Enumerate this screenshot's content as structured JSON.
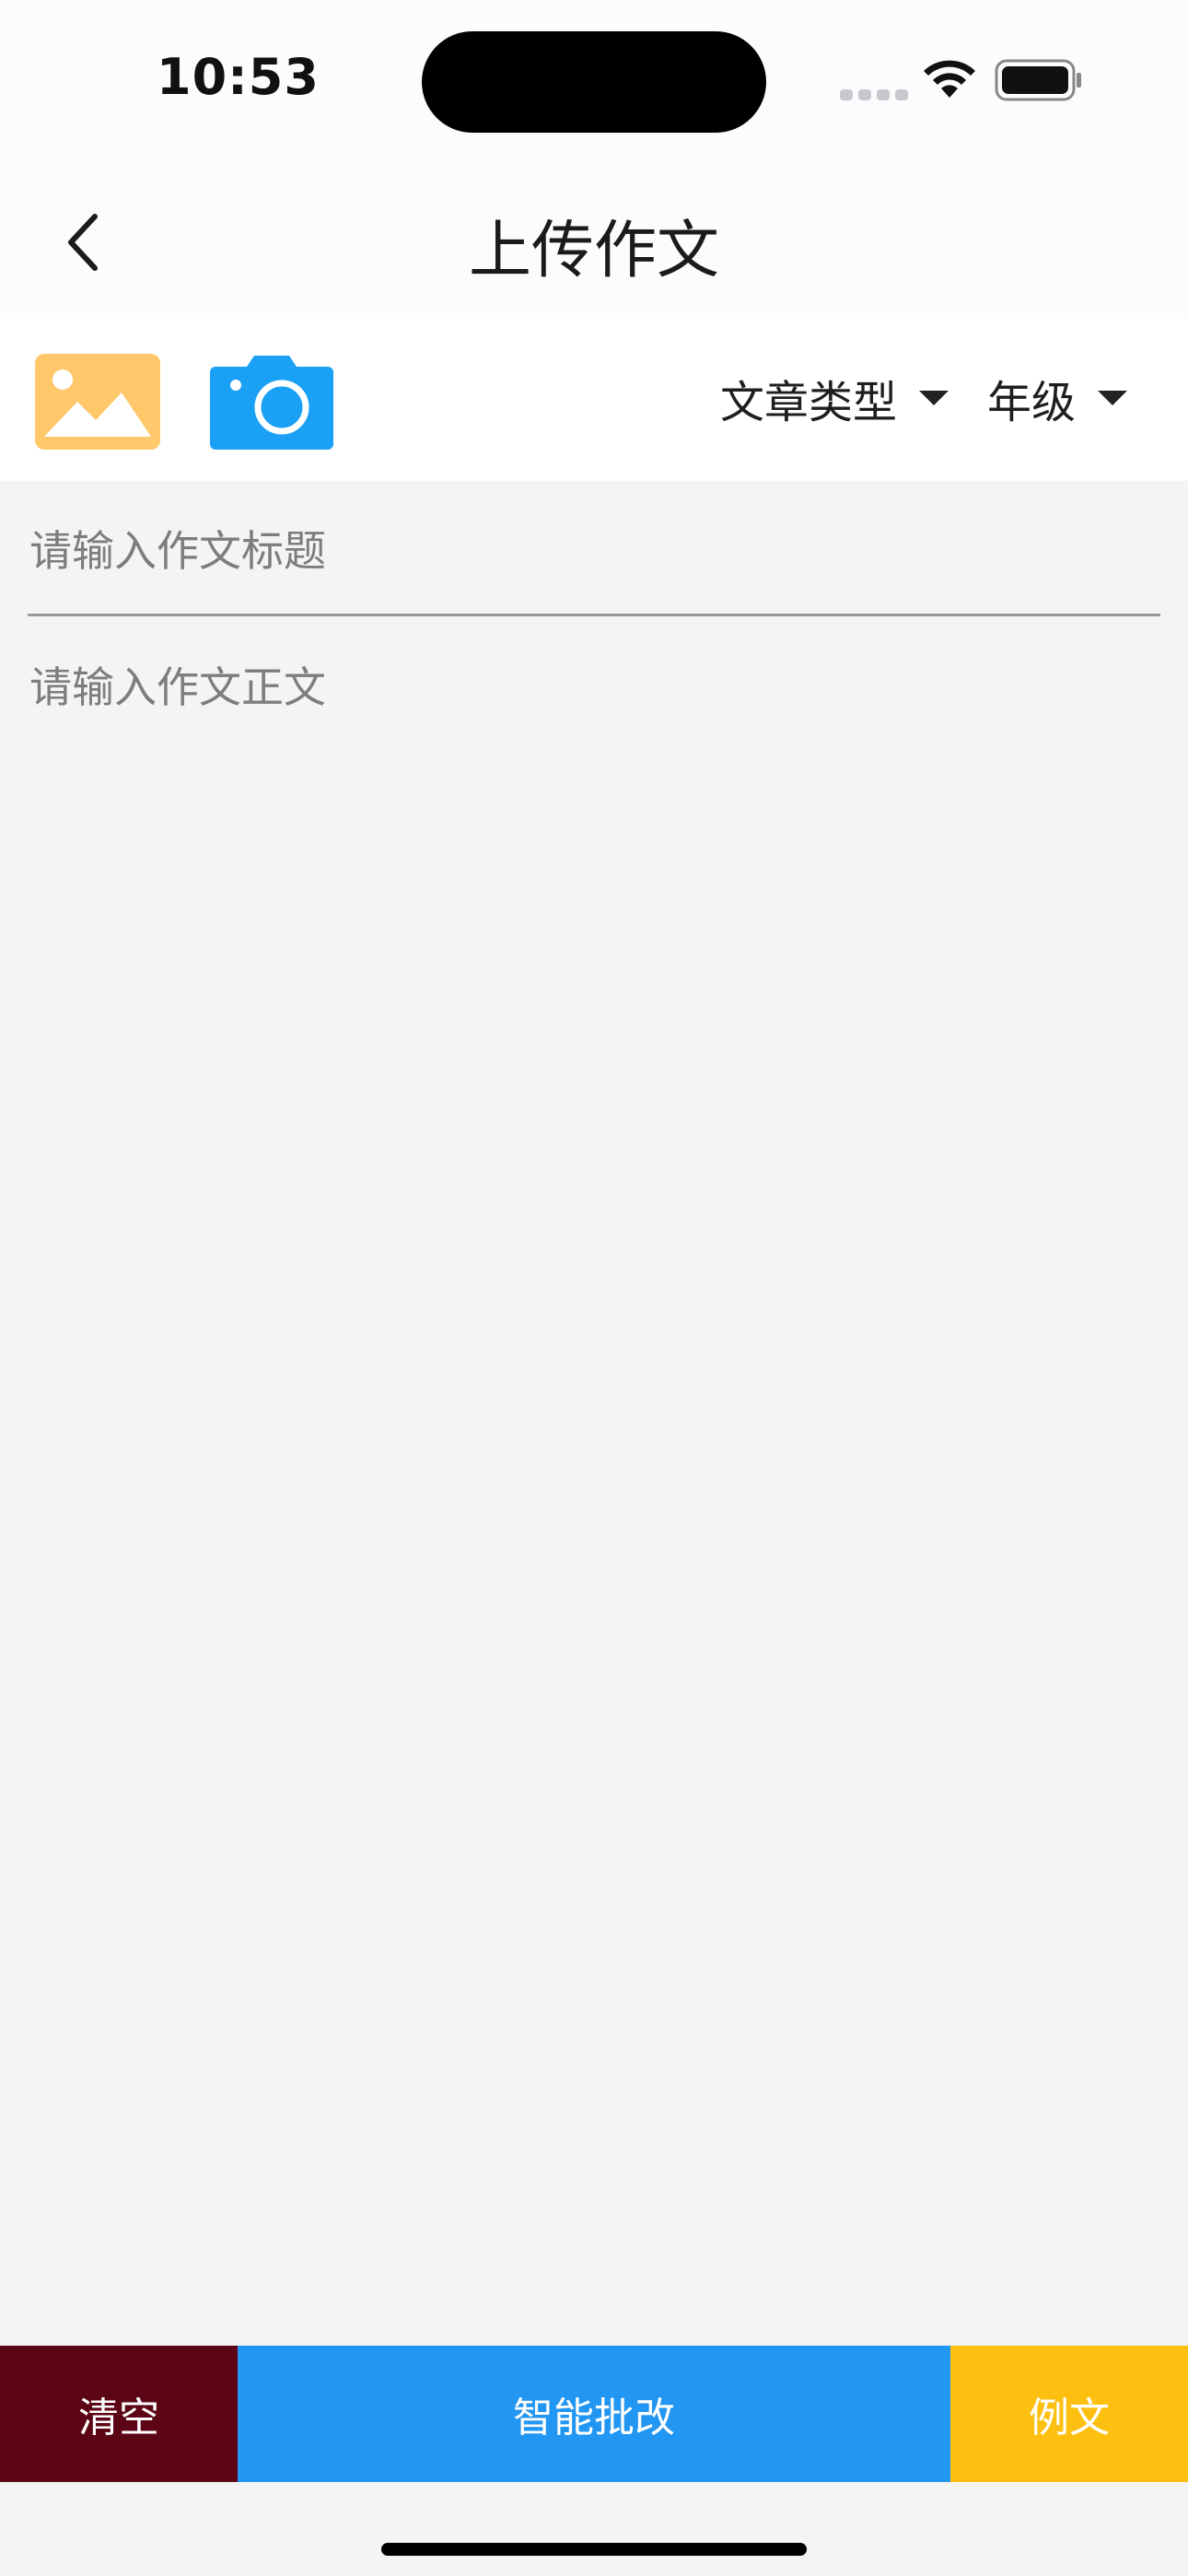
{
  "status_bar": {
    "time": "10:53",
    "icons": [
      "signal-icon",
      "wifi-icon",
      "battery-icon"
    ]
  },
  "nav": {
    "title": "上传作文",
    "back_icon": "chevron-left-icon"
  },
  "toolbar": {
    "photo_icon": "image-gallery-icon",
    "camera_icon": "camera-icon",
    "article_type_label": "文章类型",
    "grade_label": "年级"
  },
  "form": {
    "title_placeholder": "请输入作文标题",
    "title_value": "",
    "body_placeholder": "请输入作文正文",
    "body_value": ""
  },
  "actions": {
    "clear_label": "清空",
    "smart_grade_label": "智能批改",
    "sample_label": "例文"
  },
  "colors": {
    "clear_bg": "#5c0515",
    "smart_grade_bg": "#2196f2",
    "sample_bg": "#fec010",
    "gallery_icon": "#ffc86a",
    "camera_icon": "#1aa0f5"
  }
}
